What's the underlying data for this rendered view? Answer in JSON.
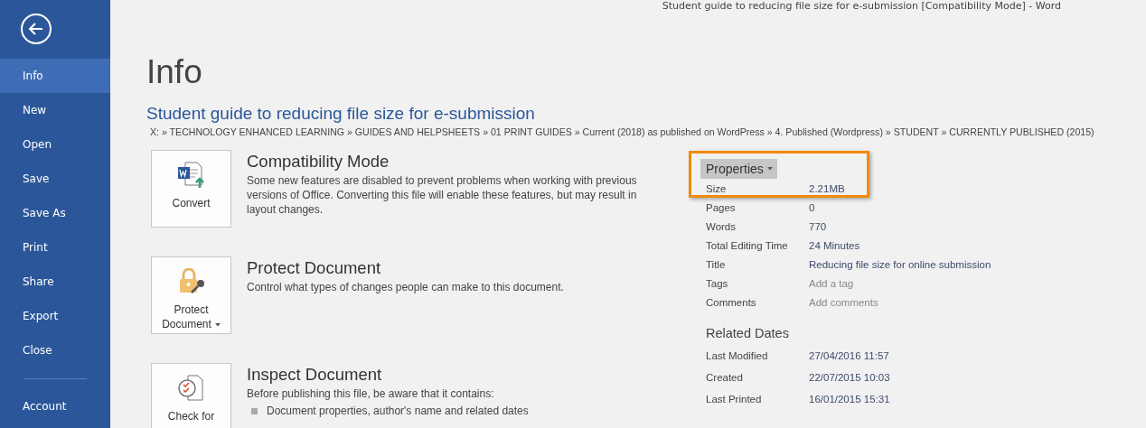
{
  "window": {
    "title": "Student guide to reducing file size for e-submission [Compatibility Mode] - Word"
  },
  "sidebar": {
    "items": [
      {
        "label": "Info",
        "selected": true
      },
      {
        "label": "New",
        "selected": false
      },
      {
        "label": "Open",
        "selected": false
      },
      {
        "label": "Save",
        "selected": false
      },
      {
        "label": "Save As",
        "selected": false
      },
      {
        "label": "Print",
        "selected": false
      },
      {
        "label": "Share",
        "selected": false
      },
      {
        "label": "Export",
        "selected": false
      },
      {
        "label": "Close",
        "selected": false
      }
    ],
    "footer_items": [
      {
        "label": "Account",
        "selected": false
      }
    ]
  },
  "page": {
    "heading": "Info",
    "document_title": "Student guide to reducing file size for e-submission",
    "path": "X: » TECHNOLOGY ENHANCED LEARNING » GUIDES AND HELPSHEETS » 01 PRINT GUIDES » Current (2018) as published on WordPress » 4. Published (Wordpress) » STUDENT » CURRENTLY PUBLISHED (2015)"
  },
  "sections": [
    {
      "kind": "convert",
      "button": [
        "Convert"
      ],
      "dropdown": false,
      "title": "Compatibility Mode",
      "description": "Some new features are disabled to prevent problems when working with previous versions of Office. Converting this file will enable these features, but may result in layout changes."
    },
    {
      "kind": "protect",
      "button": [
        "Protect",
        "Document"
      ],
      "dropdown": true,
      "title": "Protect Document",
      "description": "Control what types of changes people can make to this document."
    },
    {
      "kind": "inspect",
      "button": [
        "Check for"
      ],
      "dropdown": false,
      "title": "Inspect Document",
      "description": "Before publishing this file, be aware that it contains:",
      "bullets": [
        "Document properties, author's name and related dates"
      ]
    }
  ],
  "properties": {
    "heading": "Properties",
    "highlighted": true,
    "rows": [
      {
        "label": "Size",
        "value": "2.21MB"
      },
      {
        "label": "Pages",
        "value": "0"
      },
      {
        "label": "Words",
        "value": "770"
      },
      {
        "label": "Total Editing Time",
        "value": "24 Minutes"
      },
      {
        "label": "Title",
        "value": "Reducing file size for online submission"
      },
      {
        "label": "Tags",
        "placeholder": "Add a tag"
      },
      {
        "label": "Comments",
        "placeholder": "Add comments"
      }
    ]
  },
  "related_dates": {
    "heading": "Related Dates",
    "rows": [
      {
        "label": "Last Modified",
        "value": "27/04/2016 11:57"
      },
      {
        "label": "Created",
        "value": "22/07/2015 10:03"
      },
      {
        "label": "Last Printed",
        "value": "16/01/2015 15:31"
      }
    ]
  }
}
